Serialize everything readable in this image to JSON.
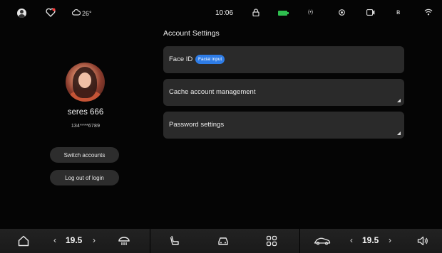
{
  "status_bar": {
    "weather_temp": "26°",
    "time": "10:06",
    "battery_color": "#2fbf4f",
    "icons": [
      "avatar-icon",
      "heart-icon",
      "cloud-icon",
      "lock-icon",
      "battery-icon",
      "signal-icon",
      "location-icon",
      "camera-icon",
      "bluetooth-icon",
      "wifi-icon"
    ]
  },
  "profile": {
    "username": "seres 666",
    "phone": "134****6789",
    "switch_label": "Switch accounts",
    "logout_label": "Log out of login"
  },
  "settings": {
    "title": "Account Settings",
    "items": [
      {
        "label": "Face ID",
        "badge": "Facial input"
      },
      {
        "label": "Cache account management"
      },
      {
        "label": "Password settings"
      }
    ],
    "accent_color": "#2e7ce6"
  },
  "dock": {
    "left_temp": "19.5",
    "right_temp": "19.5",
    "icons": [
      "home-icon",
      "defrost-icon",
      "seat-icon",
      "car-icon",
      "apps-grid-icon",
      "car-side-icon",
      "volume-icon"
    ]
  }
}
